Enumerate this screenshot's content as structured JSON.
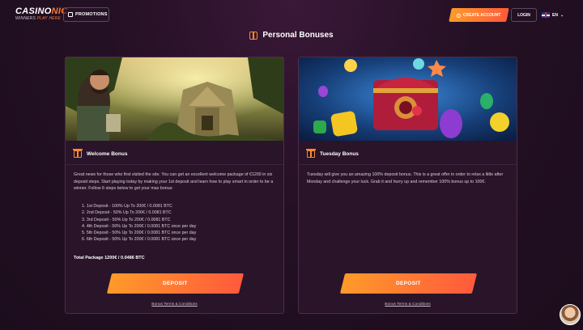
{
  "header": {
    "logo_main_left": "CASINO",
    "logo_main_right": "NIC",
    "logo_sub_left": "WINNERS",
    "logo_sub_right": "PLAY HERE",
    "promotions_label": "PROMOTIONS",
    "create_account_label": "CREATE ACCOUNT",
    "login_label": "LOGIN",
    "language": "EN"
  },
  "page": {
    "title": "Personal Bonuses"
  },
  "bonuses": [
    {
      "title": "Welcome Bonus",
      "description": "Great news for those who first visited the site. You can get an excellent welcome package of €1200 in six deposit steps. Start playing today by making your 1st deposit and learn how to play smart in order to be a winner. Follow 6 steps below to get your max bonus:",
      "steps": [
        "1. 1st Deposit - 100% Up To 200€ / 0.0081 BTC",
        "2. 2nd Deposit - 50% Up To 200€ / 0.0081 BTC",
        "3. 3rd Deposit - 50% Up To 200€ / 0.0081 BTC",
        "4. 4th Deposit - 50% Up To 200€ / 0.0081 BTC once per day",
        "5. 5th Deposit - 50% Up To 200€ / 0.0081 BTC once per day",
        "6. 6th Deposit - 50% Up To 200€ / 0.0081 BTC once per day"
      ],
      "total": "Total Package 1200€ / 0.0486 BTC",
      "button": "DEPOSIT",
      "terms": "Bonus Terms & Conditions"
    },
    {
      "title": "Tuesday Bonus",
      "description": "Tuesday will give you an amazing 100% deposit bonus. This is a great offer in order to relax a little after Monday and challenge your luck. Grab it and hurry up and remember 100% bonus up to 100€.",
      "button": "DEPOSIT",
      "terms": "Bonus Terms & Conditions"
    }
  ]
}
